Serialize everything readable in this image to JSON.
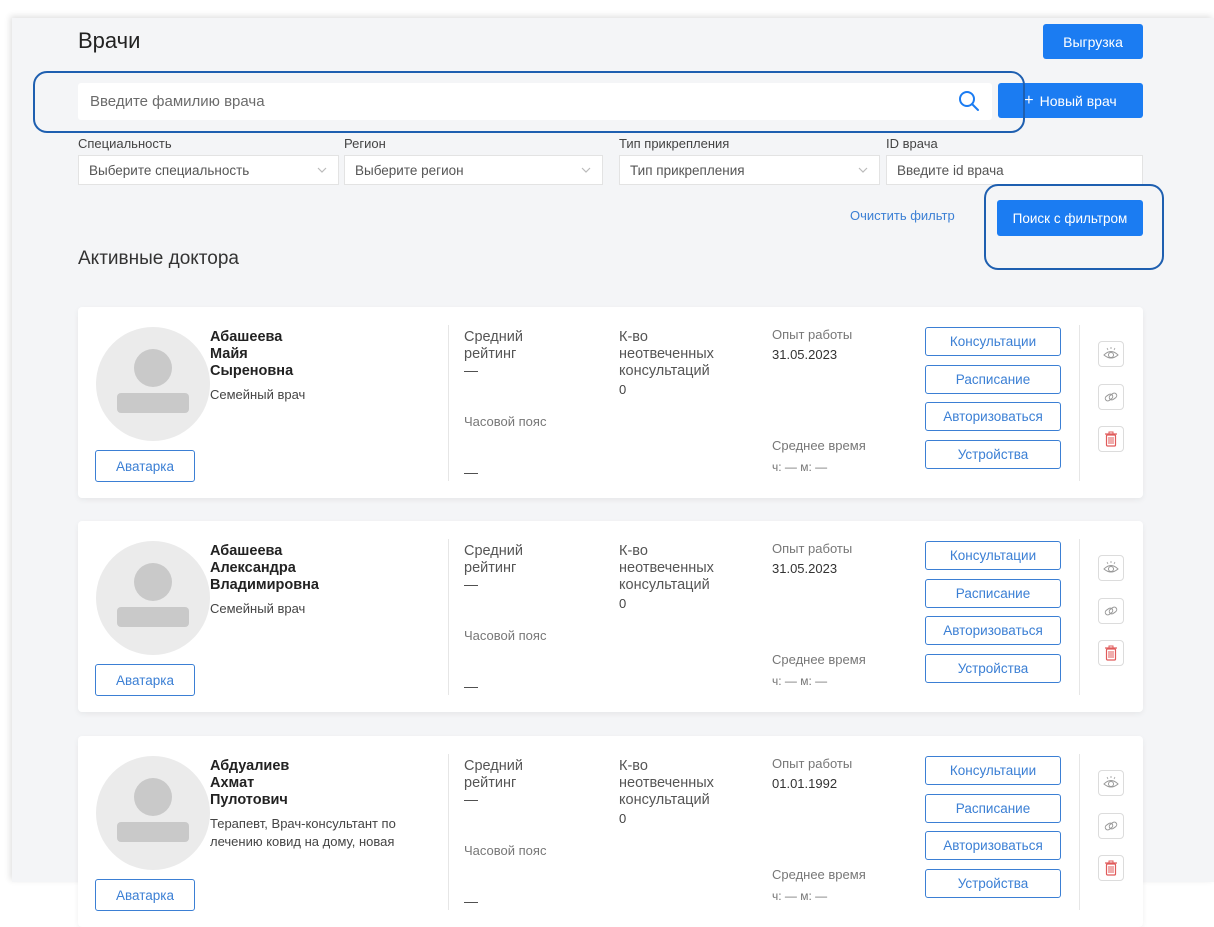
{
  "header": {
    "title": "Врачи",
    "export_label": "Выгрузка",
    "new_doctor_label": "Новый врач",
    "new_doctor_plus": "+"
  },
  "search": {
    "placeholder": "Введите фамилию врача"
  },
  "filters": {
    "specialty": {
      "label": "Специальность",
      "value": "Выберите специальность"
    },
    "region": {
      "label": "Регион",
      "value": "Выберите регион"
    },
    "attachment_type": {
      "label": "Тип прикрепления",
      "value": "Тип прикрепления"
    },
    "doctor_id": {
      "label": "ID врача",
      "placeholder": "Введите id врача"
    },
    "clear_label": "Очистить фильтр",
    "search_label": "Поиск с фильтром"
  },
  "section_title": "Активные доктора",
  "labels": {
    "avatar_button": "Аватарка",
    "avg_rating_line1": "Средний",
    "avg_rating_line2": "рейтинг",
    "unanswered_line1": "К-во",
    "unanswered_line2": "неотвеченных",
    "unanswered_line3": "консультаций",
    "timezone": "Часовой пояс",
    "experience": "Опыт работы",
    "avg_time": "Среднее время",
    "avg_time_value": "ч: — м: —",
    "consultations": "Консультации",
    "schedule": "Расписание",
    "authorize": "Авторизоваться",
    "devices": "Устройства"
  },
  "doctors": [
    {
      "last_name": "Абашеева",
      "first_name": "Майя",
      "patronymic": "Сыреновна",
      "specialty": "Семейный врач",
      "rating": "—",
      "unanswered": "0",
      "timezone_value": "—",
      "experience_date": "31.05.2023"
    },
    {
      "last_name": "Абашеева",
      "first_name": "Александра",
      "patronymic": "Владимировна",
      "specialty": "Семейный врач",
      "rating": "—",
      "unanswered": "0",
      "timezone_value": "—",
      "experience_date": "31.05.2023"
    },
    {
      "last_name": "Абдуалиев",
      "first_name": "Ахмат",
      "patronymic": "Пулотович",
      "specialty": "Терапевт, Врач-консультант по лечению ковид на дому, новая",
      "rating": "—",
      "unanswered": "0",
      "timezone_value": "—",
      "experience_date": "01.01.1992"
    }
  ],
  "colors": {
    "primary": "#1b7cf2",
    "outline": "#3b7fd4",
    "highlight": "#1e5fb0",
    "delete": "#e05a5a"
  }
}
